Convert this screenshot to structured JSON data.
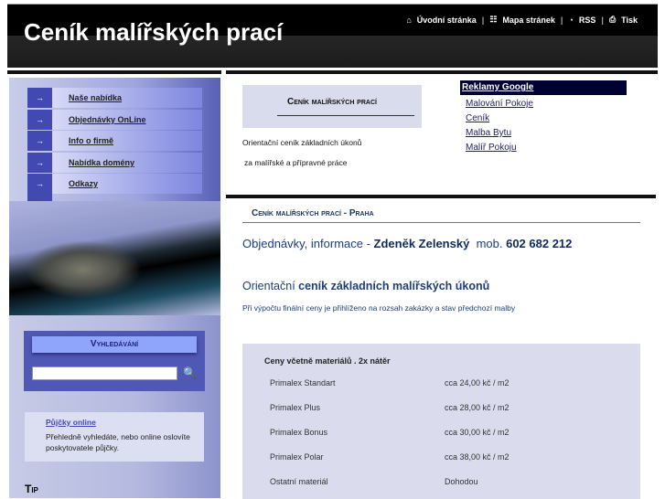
{
  "header": {
    "title": "Ceník malířských prací",
    "nav": [
      {
        "icon": "home-icon",
        "label": "Úvodní stránka"
      },
      {
        "icon": "sitemap-icon",
        "label": "Mapa stránek"
      },
      {
        "icon": "rss-icon",
        "label": "RSS"
      },
      {
        "icon": "print-icon",
        "label": "Tisk"
      }
    ]
  },
  "sidebar": {
    "menu": [
      "Naše nabídka",
      "Objednávky OnLine",
      "Info o firmě",
      "Nabídka domény",
      "Odkazy"
    ],
    "search": {
      "title": "Vyhledávání",
      "value": ""
    },
    "loan": {
      "link": "Půjčky online",
      "text": "Přehledně vyhledáte, nebo online oslovíte poskytovatele půjčky."
    },
    "tip": "Tip"
  },
  "main": {
    "title_box": "Ceník malířských prací",
    "intro": [
      "Orientační ceník základních úkonů",
      "za malířské a přípravné práce"
    ],
    "ads": {
      "heading": "Reklamy Google",
      "links": [
        "Malování Pokoje",
        "Ceník",
        "Malba Bytu",
        "Malíř Pokoju"
      ]
    },
    "section_title": "Ceník malířských prací - Praha",
    "contact": {
      "prefix": "Objednávky, informace - ",
      "name": "Zdeněk Zelenský",
      "mob": "mob.",
      "phone": "602 682 212"
    },
    "orient": {
      "prefix": "Orientační ",
      "bold": "ceník základních malířských úkonů"
    },
    "note": "Při výpočtu finální ceny je přihlíženo na rozsah zakázky a stav předchozí malby",
    "table": {
      "heading": "Ceny včetně materiálů . 2x nátěr",
      "rows": [
        [
          "Primalex Standart",
          "cca 24,00 kč / m2"
        ],
        [
          "Primalex Plus",
          "cca 28,00 kč / m2"
        ],
        [
          "Primalex Bonus",
          "cca 30,00  kč / m2"
        ],
        [
          "Primalex Polar",
          "cca 38,00 kč / m2"
        ],
        [
          "Ostatní materiál",
          "Dohodou"
        ]
      ]
    }
  }
}
